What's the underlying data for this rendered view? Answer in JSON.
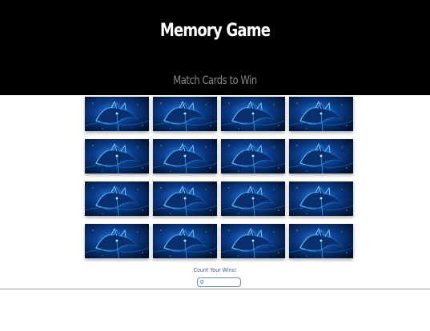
{
  "header": {
    "title": "Memory Game",
    "subtitle": "Match Cards to Win"
  },
  "board": {
    "rows": 4,
    "columns": 4,
    "cards": [
      {
        "state": "face-down",
        "back_image": "blue-neon-cat-card-back"
      },
      {
        "state": "face-down",
        "back_image": "blue-neon-cat-card-back"
      },
      {
        "state": "face-down",
        "back_image": "blue-neon-cat-card-back"
      },
      {
        "state": "face-down",
        "back_image": "blue-neon-cat-card-back"
      },
      {
        "state": "face-down",
        "back_image": "blue-neon-cat-card-back"
      },
      {
        "state": "face-down",
        "back_image": "blue-neon-cat-card-back"
      },
      {
        "state": "face-down",
        "back_image": "blue-neon-cat-card-back"
      },
      {
        "state": "face-down",
        "back_image": "blue-neon-cat-card-back"
      },
      {
        "state": "face-down",
        "back_image": "blue-neon-cat-card-back"
      },
      {
        "state": "face-down",
        "back_image": "blue-neon-cat-card-back"
      },
      {
        "state": "face-down",
        "back_image": "blue-neon-cat-card-back"
      },
      {
        "state": "face-down",
        "back_image": "blue-neon-cat-card-back"
      },
      {
        "state": "face-down",
        "back_image": "blue-neon-cat-card-back"
      },
      {
        "state": "face-down",
        "back_image": "blue-neon-cat-card-back"
      },
      {
        "state": "face-down",
        "back_image": "blue-neon-cat-card-back"
      },
      {
        "state": "face-down",
        "back_image": "blue-neon-cat-card-back"
      }
    ]
  },
  "counter": {
    "label": "Count Your Wins!",
    "value": "0"
  },
  "colors": {
    "header_bg": "#000000",
    "title": "#ffffff",
    "subtitle": "#8a8a8a",
    "card_dark": "#03112a",
    "card_glow": "#1f8fff",
    "counter_text": "#3d5a99"
  }
}
